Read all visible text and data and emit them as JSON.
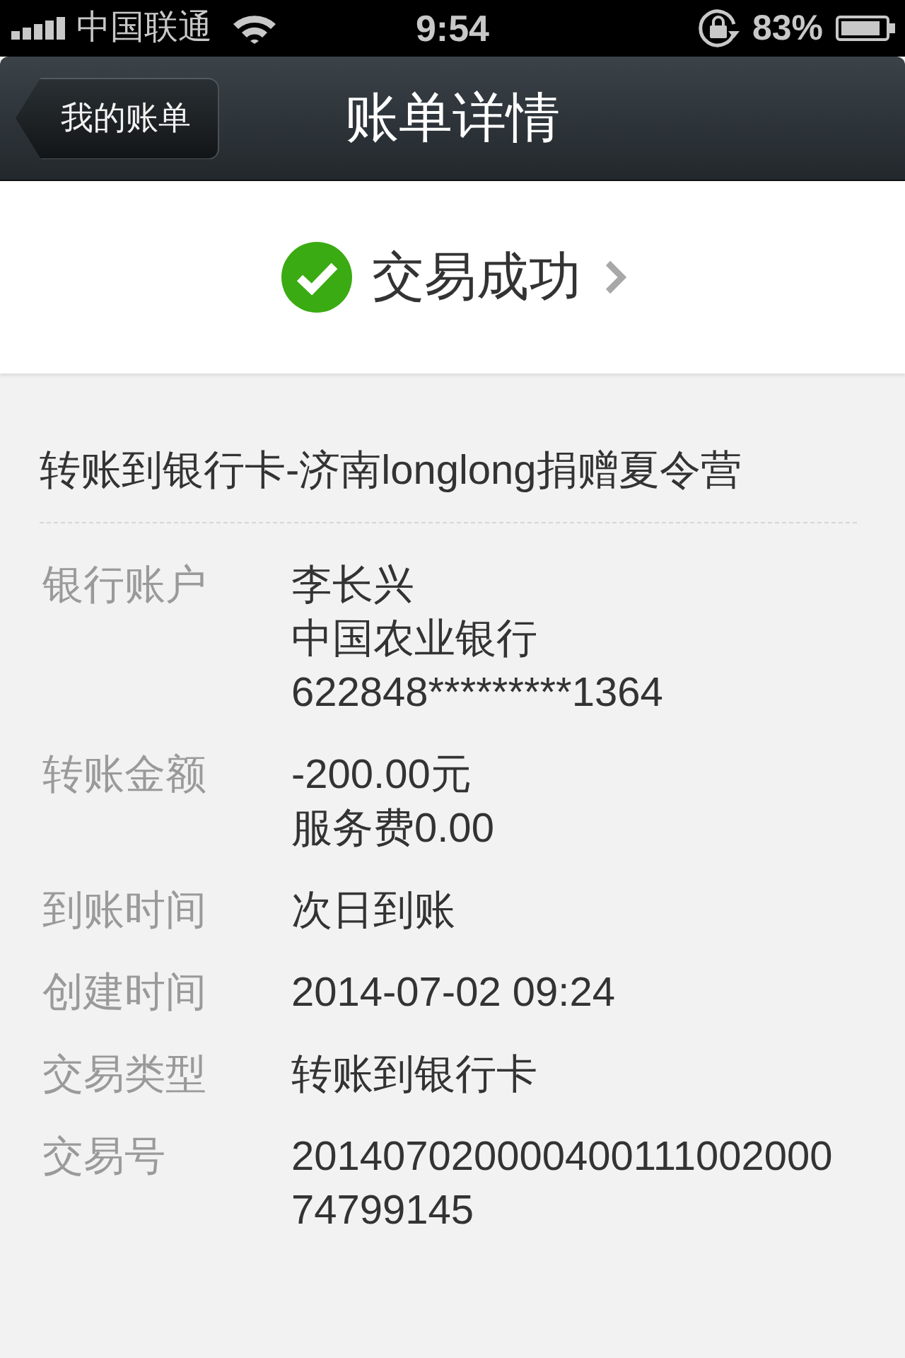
{
  "status_bar": {
    "carrier": "中国联通",
    "time": "9:54",
    "battery": "83%"
  },
  "nav_bar": {
    "back_button": "我的账单",
    "title": "账单详情"
  },
  "status": {
    "text": "交易成功"
  },
  "description": "转账到银行卡-济南longlong捐赠夏令营",
  "details": [
    {
      "label": "银行账户",
      "lines": [
        "李长兴",
        "中国农业银行",
        "622848*********1364"
      ]
    },
    {
      "label": "转账金额",
      "lines": [
        "-200.00元",
        "服务费0.00"
      ]
    },
    {
      "label": "到账时间",
      "lines": [
        "次日到账"
      ]
    },
    {
      "label": "创建时间",
      "lines": [
        "2014-07-02 09:24"
      ]
    },
    {
      "label": "交易类型",
      "lines": [
        "转账到银行卡"
      ]
    },
    {
      "label": "交易号",
      "lines": [
        "201407020000400111002000",
        "74799145"
      ]
    }
  ]
}
